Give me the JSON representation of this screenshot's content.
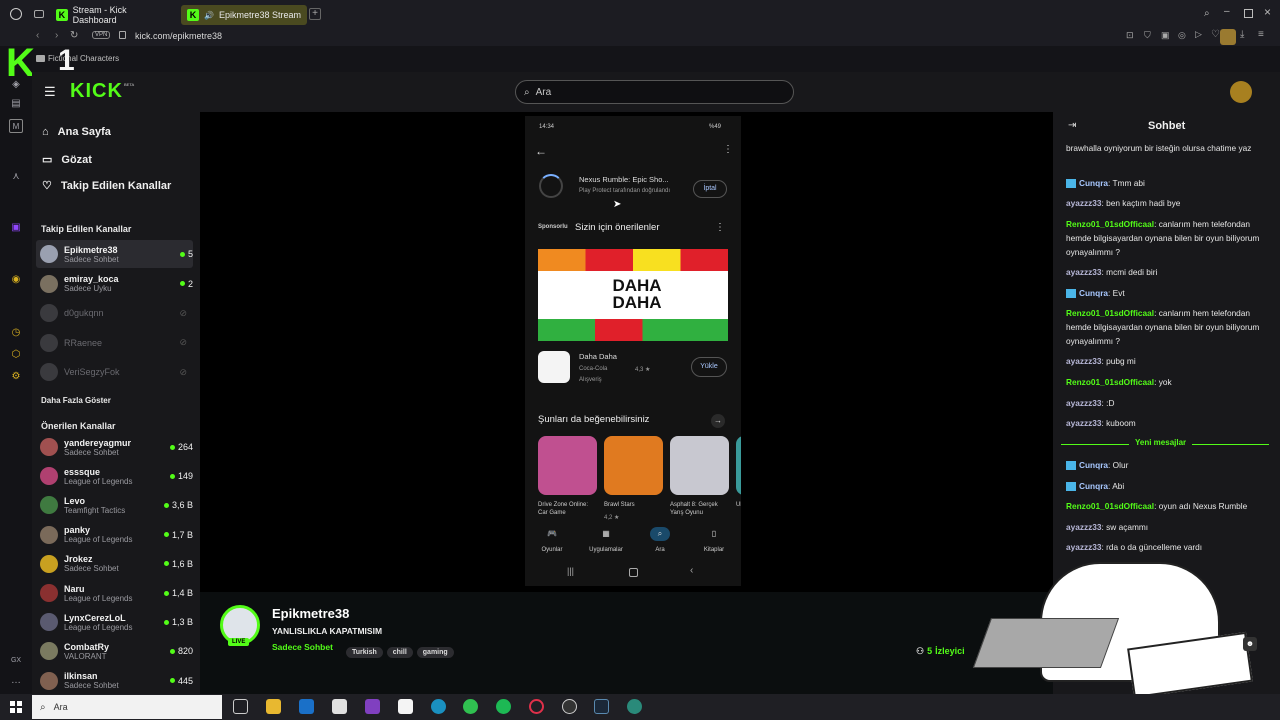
{
  "browser": {
    "tabs": [
      "Stream - Kick Dashboard",
      "Epikmetre38 Stream"
    ],
    "vpn": "VPN",
    "url": "kick.com/epikmetre38",
    "bookmark": "Fictional Characters"
  },
  "overlay": {
    "logo_letter": "K",
    "logo_number": "1"
  },
  "kick": {
    "logo": "KICK",
    "beta": "BETA",
    "search_placeholder": "Ara"
  },
  "sidebar": {
    "nav": [
      "Ana Sayfa",
      "Gözat",
      "Takip Edilen Kanallar"
    ],
    "followed_title": "Takip Edilen Kanallar",
    "followed": [
      {
        "name": "Epikmetre38",
        "sub": "Sadece Sohbet",
        "viewers": "5",
        "color": "#9aa0b0"
      },
      {
        "name": "emiray_koca",
        "sub": "Sadece Uyku",
        "viewers": "2",
        "color": "#7a7060"
      },
      {
        "name": "d0gukqnn",
        "sub": "",
        "viewers": "",
        "color": "#3a3a3e"
      },
      {
        "name": "RRaenee",
        "sub": "",
        "viewers": "",
        "color": "#3a3a3e"
      },
      {
        "name": "VeriSegzyFok",
        "sub": "",
        "viewers": "",
        "color": "#3a3a3e"
      }
    ],
    "more": "Daha Fazla Göster",
    "suggested_title": "Önerilen Kanallar",
    "suggested": [
      {
        "name": "yandereyagmur",
        "sub": "Sadece Sohbet",
        "viewers": "264",
        "color": "#a05050"
      },
      {
        "name": "esssque",
        "sub": "League of Legends",
        "viewers": "149",
        "color": "#b04070"
      },
      {
        "name": "Levo",
        "sub": "Teamfight Tactics",
        "viewers": "3,6 B",
        "color": "#3f7a40"
      },
      {
        "name": "panky",
        "sub": "League of Legends",
        "viewers": "1,7 B",
        "color": "#7a6a5a"
      },
      {
        "name": "Jrokez",
        "sub": "Sadece Sohbet",
        "viewers": "1,6 B",
        "color": "#c8a020"
      },
      {
        "name": "Naru",
        "sub": "League of Legends",
        "viewers": "1,4 B",
        "color": "#8a3030"
      },
      {
        "name": "LynxCerezLoL",
        "sub": "League of Legends",
        "viewers": "1,3 B",
        "color": "#5a5a70"
      },
      {
        "name": "CombatRy",
        "sub": "VALORANT",
        "viewers": "820",
        "color": "#7a7a60"
      },
      {
        "name": "ilkinsan",
        "sub": "Sadece Sohbet",
        "viewers": "445",
        "color": "#806050"
      }
    ]
  },
  "phone": {
    "status_time": "14:34",
    "status_right": "%49",
    "app_name": "Nexus Rumble: Epic Sho...",
    "app_sub": "Play Protect tarafından doğrulandı",
    "cancel": "İptal",
    "sponsored": "Sponsorlu",
    "rec_title": "Sizin için önerilenler",
    "banner_text": "DAHA DAHA",
    "app2_name": "Daha Daha",
    "app2_dev": "Coca-Cola",
    "app2_rating": "4,3 ★",
    "app2_cat": "Alışveriş",
    "install": "Yükle",
    "like_title": "Şunları da beğenebilirsiniz",
    "games": [
      {
        "name": "Drive Zone Online: Car Game",
        "rating": ""
      },
      {
        "name": "Brawl Stars",
        "rating": "4,2 ★"
      },
      {
        "name": "Asphalt 8: Gerçek Yarış Oyunu",
        "rating": ""
      },
      {
        "name": "Ul M",
        "rating": ""
      }
    ],
    "bottom_nav": [
      "Oyunlar",
      "Uygulamalar",
      "Ara",
      "Kitaplar"
    ]
  },
  "stream": {
    "channel": "Epikmetre38",
    "live": "LIVE",
    "title": "YANLISLIKLA KAPATMISIM",
    "category": "Sadece Sohbet",
    "tags": [
      "Turkish",
      "chill",
      "gaming"
    ],
    "viewers": "5",
    "viewers_label": "İzleyici"
  },
  "chat": {
    "title": "Sohbet",
    "messages": [
      {
        "user": "",
        "text": "brawhalla oyniyorum bir isteğin olursa chatime yaz",
        "color": "#e6e6e6"
      },
      {
        "user": "Cunqra",
        "text": "Tmm abi",
        "color": "#a8c8ff",
        "badge": true
      },
      {
        "user": "ayazzz33",
        "text": "ben kaçtım hadi bye",
        "color": "#b8b8d8"
      },
      {
        "user": "Renzo01_01sdOfficaal",
        "text": "canlarım hem telefondan hemde bilgisayardan oynana bilen bir oyun biliyorum oynayalımmı ?",
        "color": "#53fc18"
      },
      {
        "user": "ayazzz33",
        "text": "mcmi dedi biri",
        "color": "#b8b8d8"
      },
      {
        "user": "Cunqra",
        "text": "Evt",
        "color": "#a8c8ff",
        "badge": true
      },
      {
        "user": "Renzo01_01sdOfficaal",
        "text": "canlarım hem telefondan hemde bilgisayardan oynana bilen bir oyun biliyorum oynayalımmı ?",
        "color": "#53fc18"
      },
      {
        "user": "ayazzz33",
        "text": "pubg mi",
        "color": "#b8b8d8"
      },
      {
        "user": "Renzo01_01sdOfficaal",
        "text": "yok",
        "color": "#53fc18"
      },
      {
        "user": "ayazzz33",
        "text": ":D",
        "color": "#b8b8d8"
      },
      {
        "user": "ayazzz33",
        "text": "kuboom",
        "color": "#b8b8d8"
      }
    ],
    "new_messages": "Yeni mesajlar",
    "messages2": [
      {
        "user": "Cunqra",
        "text": "Olur",
        "color": "#a8c8ff",
        "badge": true
      },
      {
        "user": "Cunqra",
        "text": "Abi",
        "color": "#a8c8ff",
        "badge": true
      },
      {
        "user": "Renzo01_01sdOfficaal",
        "text": "oyun adı Nexus Rumble",
        "color": "#53fc18"
      },
      {
        "user": "ayazzz33",
        "text": "sw açammı",
        "color": "#b8b8d8"
      },
      {
        "user": "ayazzz33",
        "text": "rda o da güncelleme vardı",
        "color": "#b8b8d8"
      }
    ]
  },
  "taskbar": {
    "search": "Ara"
  }
}
